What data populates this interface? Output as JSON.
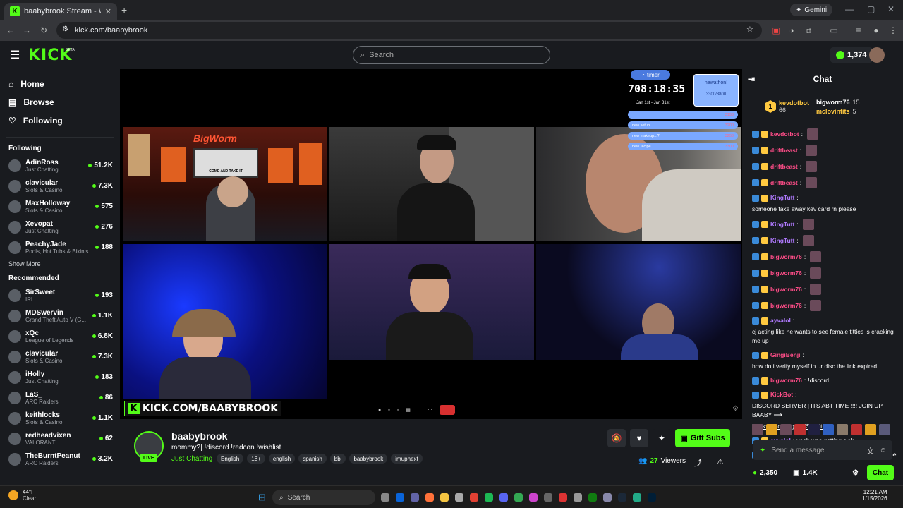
{
  "browser": {
    "tab_title": "baabybrook Stream - Watch Li...",
    "url": "kick.com/baabybrook",
    "gemini_label": "Gemini"
  },
  "header": {
    "logo": "KICK",
    "beta": "BETA",
    "search_placeholder": "Search",
    "points": "1,374"
  },
  "sidebar": {
    "nav": [
      {
        "label": "Home",
        "icon": "home-icon"
      },
      {
        "label": "Browse",
        "icon": "browse-icon"
      },
      {
        "label": "Following",
        "icon": "heart-icon"
      }
    ],
    "following_title": "Following",
    "following": [
      {
        "name": "AdinRoss",
        "category": "Just Chatting",
        "viewers": "51.2K"
      },
      {
        "name": "clavicular",
        "category": "Slots & Casino",
        "viewers": "7.3K"
      },
      {
        "name": "MaxHolloway",
        "category": "Slots & Casino",
        "viewers": "575"
      },
      {
        "name": "Xevopat",
        "category": "Just Chatting",
        "viewers": "276"
      },
      {
        "name": "PeachyJade",
        "category": "Pools, Hot Tubs & Bikinis",
        "viewers": "188"
      }
    ],
    "show_more": "Show More",
    "recommended_title": "Recommended",
    "recommended": [
      {
        "name": "SirSweet",
        "category": "IRL",
        "viewers": "193"
      },
      {
        "name": "MDSwervin",
        "category": "Grand Theft Auto V (G...",
        "viewers": "1.1K"
      },
      {
        "name": "xQc",
        "category": "League of Legends",
        "viewers": "6.8K"
      },
      {
        "name": "clavicular",
        "category": "Slots & Casino",
        "viewers": "7.3K"
      },
      {
        "name": "iHolly",
        "category": "Just Chatting",
        "viewers": "183"
      },
      {
        "name": "LaS_",
        "category": "ARC Raiders",
        "viewers": "86"
      },
      {
        "name": "keithlocks",
        "category": "Slots & Casino",
        "viewers": "1.1K"
      },
      {
        "name": "redheadvixen",
        "category": "VALORANT",
        "viewers": "62"
      },
      {
        "name": "TheBurntPeanut",
        "category": "ARC Raiders",
        "viewers": "3.2K"
      }
    ]
  },
  "video": {
    "overlay_url": "KICK.COM/BAABYBROOK",
    "timer_label": "timer",
    "timer_value": "708:18:35",
    "timer_dates": "Jan 1st - Jan 31st",
    "subathon": "newathon!",
    "subathon_count": "3300/3800",
    "goals": [
      {
        "label": "",
        "value": "3150"
      },
      {
        "label": "new setup",
        "value": "3200"
      },
      {
        "label": "new makeup...?",
        "value": "3250"
      },
      {
        "label": "new recipe",
        "value": "3300"
      }
    ],
    "banner_title": "BigWorm",
    "banner_sign": "COME AND TAKE IT"
  },
  "stream": {
    "name": "baabybrook",
    "title": "mommy?| !discord !redcon !wishlist",
    "category": "Just Chatting",
    "live": "LIVE",
    "tags": [
      "English",
      "18+",
      "english",
      "spanish",
      "bbl",
      "baabybrook",
      "imupnext"
    ],
    "viewers": "27",
    "viewers_label": "Viewers",
    "gift_label": "Gift Subs"
  },
  "chat": {
    "title": "Chat",
    "top": [
      {
        "rank": "1",
        "name": "kevdotbot",
        "count": "66"
      },
      {
        "name": "bigworm76",
        "count": "15"
      },
      {
        "name": "mclovintits",
        "count": "5"
      }
    ],
    "messages": [
      {
        "user": "kevdotbot",
        "text": "",
        "color": "#ff4d88"
      },
      {
        "user": "driftbeast",
        "text": "",
        "color": "#ff4d88"
      },
      {
        "user": "driftbeast",
        "text": "",
        "color": "#ff4d88"
      },
      {
        "user": "driftbeast",
        "text": "",
        "color": "#ff4d88"
      },
      {
        "user": "KingTutt",
        "text": "someone take away kev card rn please",
        "color": "#b07aff"
      },
      {
        "user": "KingTutt",
        "text": "",
        "color": "#b07aff"
      },
      {
        "user": "KingTutt",
        "text": "",
        "color": "#b07aff"
      },
      {
        "user": "bigworm76",
        "text": "",
        "color": "#ff4d88"
      },
      {
        "user": "bigworm76",
        "text": "",
        "color": "#ff4d88"
      },
      {
        "user": "bigworm76",
        "text": "",
        "color": "#ff4d88"
      },
      {
        "user": "bigworm76",
        "text": "",
        "color": "#ff4d88"
      },
      {
        "user": "ayvalol",
        "text": "cj acting like he wants to see female titties is cracking me up",
        "color": "#b07aff"
      },
      {
        "user": "GingiBenji",
        "text": "how do i verify myself in ur disc the link expired",
        "color": "#ff4d88"
      },
      {
        "user": "bigworm76",
        "text": "!discord",
        "color": "#ff4d88"
      },
      {
        "user": "KickBot",
        "text": "DISCORD SERVER | ITS ABT TIME !!!! JOIN UP BAABY ⟶",
        "color": "#ff4d88"
      },
      {
        "user": "ayvalol",
        "text": "yeah was getting sick",
        "color": "#b07aff"
      },
      {
        "user": "deathkinglive",
        "text": "Hey brook can you unmute me",
        "color": "#b07aff"
      }
    ],
    "discord_link": "https://discord.gg/6ffSJ5NtCr",
    "input_placeholder": "Send a message",
    "balance": "2,350",
    "subs": "1.4K",
    "send_label": "Chat"
  },
  "taskbar": {
    "temp": "44°F",
    "weather": "Clear",
    "search": "Search",
    "time": "12:21 AM",
    "date": "1/15/2026"
  },
  "colors": {
    "accent": "#53fc18",
    "bg": "#191b1f"
  }
}
